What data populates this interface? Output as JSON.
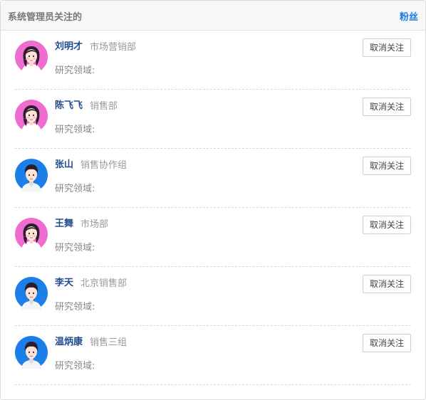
{
  "panel": {
    "title": "系统管理员关注的",
    "fans_link": "粉丝"
  },
  "follow_list": [
    {
      "name": "刘明才",
      "department": "市场营销部",
      "field_label": "研究领域:",
      "gender": "female",
      "unfollow_label": "取消关注"
    },
    {
      "name": "陈飞飞",
      "department": "销售部",
      "field_label": "研究领域:",
      "gender": "female",
      "unfollow_label": "取消关注"
    },
    {
      "name": "张山",
      "department": "销售协作组",
      "field_label": "研究领域:",
      "gender": "male",
      "unfollow_label": "取消关注"
    },
    {
      "name": "王舞",
      "department": "市场部",
      "field_label": "研究领域:",
      "gender": "female",
      "unfollow_label": "取消关注"
    },
    {
      "name": "李天",
      "department": "北京销售部",
      "field_label": "研究领域:",
      "gender": "male",
      "unfollow_label": "取消关注"
    },
    {
      "name": "温炳康",
      "department": "销售三组",
      "field_label": "研究领域:",
      "gender": "male",
      "unfollow_label": "取消关注"
    }
  ],
  "colors": {
    "accent": "#1e78e6",
    "name": "#1f4b8f",
    "female_avatar_bg": "#f06cd0",
    "male_avatar_bg": "#1a7fe8"
  }
}
